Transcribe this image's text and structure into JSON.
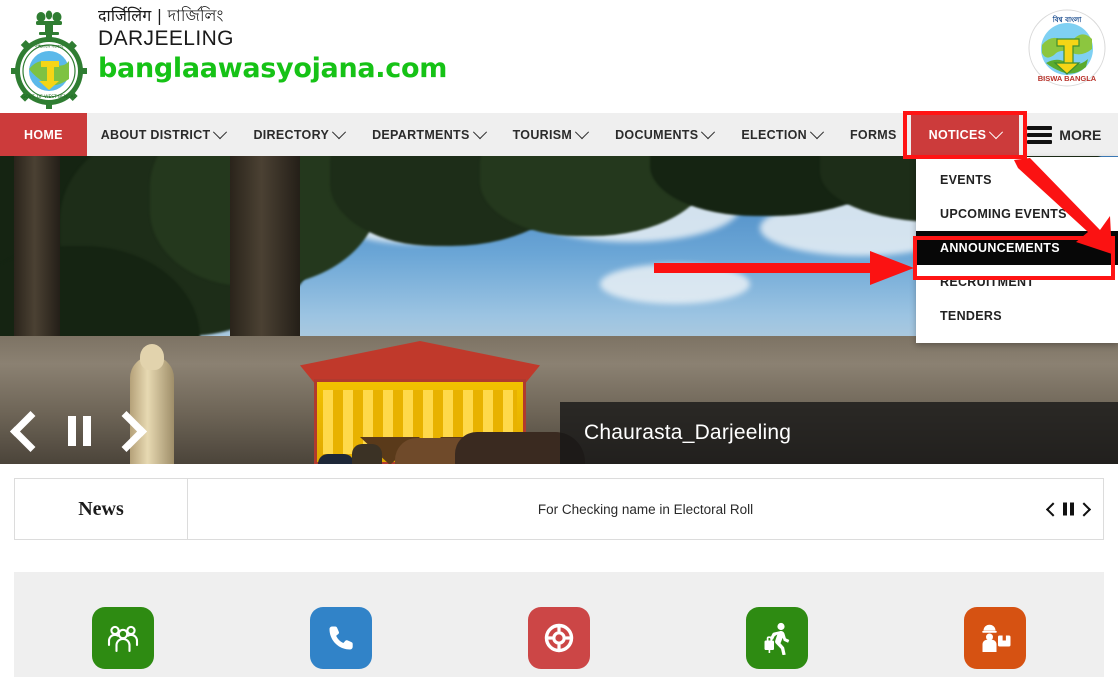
{
  "header": {
    "emblem_icon": "india-national-emblem-district-seal",
    "title_local": "दार्जिलिंग | দার্জিলিং",
    "title_en": "DARJEELING",
    "title_site": "banglaawasyojana.com",
    "biswa_logo_icon": "biswa-bangla-globe-logo",
    "biswa_top_text": "বিশ্ব বাংলা",
    "biswa_bottom_text": "BISWA BANGLA"
  },
  "nav": {
    "items": [
      {
        "label": "HOME",
        "caret": false,
        "active": true
      },
      {
        "label": "ABOUT DISTRICT",
        "caret": true,
        "active": false
      },
      {
        "label": "DIRECTORY",
        "caret": true,
        "active": false
      },
      {
        "label": "DEPARTMENTS",
        "caret": true,
        "active": false
      },
      {
        "label": "TOURISM",
        "caret": true,
        "active": false
      },
      {
        "label": "DOCUMENTS",
        "caret": true,
        "active": false
      },
      {
        "label": "ELECTION",
        "caret": true,
        "active": false
      },
      {
        "label": "FORMS",
        "caret": false,
        "active": false
      },
      {
        "label": "NOTICES",
        "caret": true,
        "active": true
      }
    ],
    "more_label": "MORE",
    "more_icon": "hamburger-menu-icon",
    "active_bg": "#cc3b3b",
    "bar_bg": "#efefef"
  },
  "dropdown": {
    "items": [
      {
        "label": "EVENTS",
        "highlighted": false
      },
      {
        "label": "UPCOMING EVENTS",
        "highlighted": false
      },
      {
        "label": "ANNOUNCEMENTS",
        "highlighted": true
      },
      {
        "label": "RECRUITMENT",
        "highlighted": false
      },
      {
        "label": "TENDERS",
        "highlighted": false
      }
    ]
  },
  "hero": {
    "caption": "Chaurasta_Darjeeling",
    "prev_icon": "chevron-left-icon",
    "pause_icon": "pause-icon",
    "next_icon": "chevron-right-icon"
  },
  "news": {
    "label": "News",
    "text": "For Checking name in Electoral Roll",
    "prev_icon": "chevron-left-icon",
    "pause_icon": "pause-icon",
    "next_icon": "chevron-right-icon"
  },
  "services": [
    {
      "icon": "people-group-icon",
      "color": "#2e8b12"
    },
    {
      "icon": "phone-call-icon",
      "color": "#3183c8"
    },
    {
      "icon": "lifebuoy-help-icon",
      "color": "#cc4646"
    },
    {
      "icon": "tourist-traveller-icon",
      "color": "#2e8b12"
    },
    {
      "icon": "worker-helmet-package-icon",
      "color": "#d65212"
    }
  ],
  "annotations": {
    "highlight_color": "#ff1414",
    "arrow_color": "#fb1212",
    "notices_highlight": "NOTICES",
    "announcements_highlight": "ANNOUNCEMENTS"
  }
}
